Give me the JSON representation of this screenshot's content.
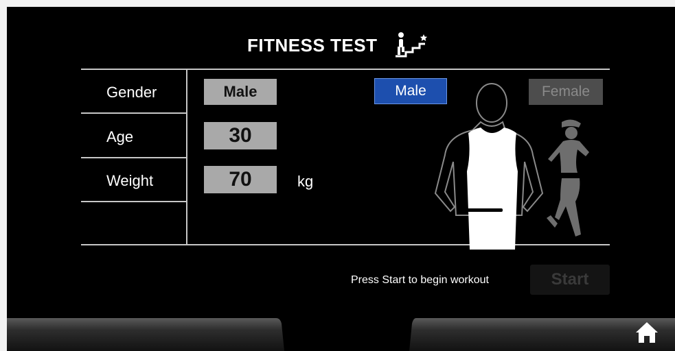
{
  "header": {
    "title": "FITNESS TEST",
    "icon": "stairs-climber-icon"
  },
  "form": {
    "gender": {
      "label": "Gender",
      "value": "Male"
    },
    "age": {
      "label": "Age",
      "value": "30"
    },
    "weight": {
      "label": "Weight",
      "value": "70",
      "unit": "kg"
    }
  },
  "gender_selector": {
    "male_label": "Male",
    "female_label": "Female",
    "selected": "Male"
  },
  "footer": {
    "hint": "Press Start to begin workout",
    "start_label": "Start"
  },
  "nav": {
    "home_icon": "home-icon"
  },
  "colors": {
    "selected": "#1d4fae",
    "disabled": "#4d4d4d",
    "value_box": "#a9a9a9"
  }
}
